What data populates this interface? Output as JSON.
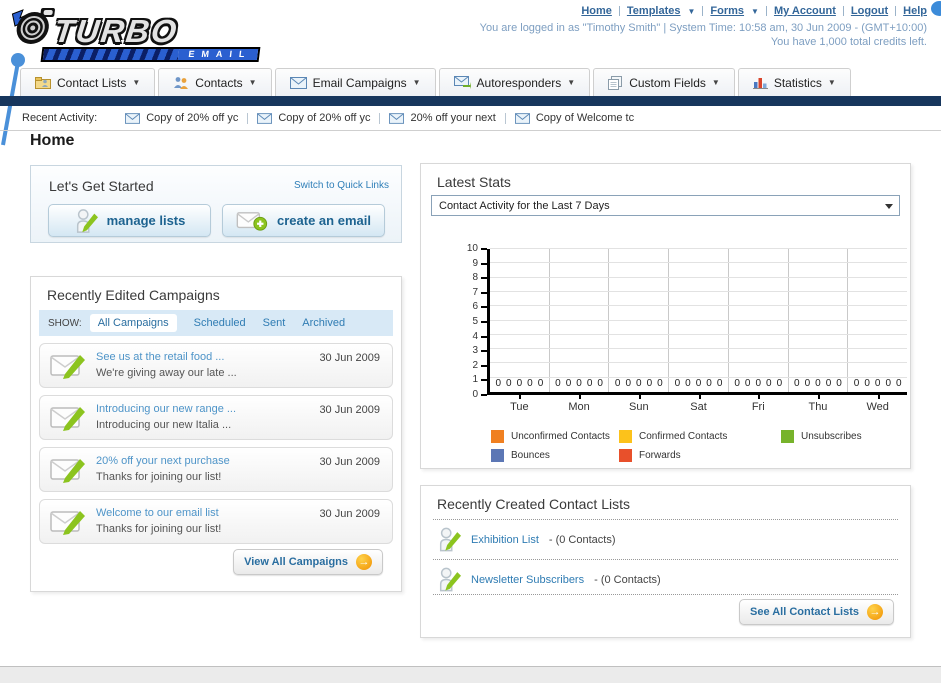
{
  "header": {
    "logo": {
      "title": "TURBO",
      "subtitle": "EMAIL"
    },
    "links": [
      {
        "label": "Home"
      },
      {
        "label": "Templates"
      },
      {
        "label": "Forms"
      },
      {
        "label": "My Account"
      },
      {
        "label": "Logout"
      },
      {
        "label": "Help"
      }
    ],
    "login_info": "You are logged in as \"Timothy Smith\" | System Time: 10:58 am, 30 Jun 2009 - (GMT+10:00)",
    "credits_info": "You have 1,000 total credits left."
  },
  "nav": {
    "tabs": [
      {
        "label": "Contact Lists"
      },
      {
        "label": "Contacts"
      },
      {
        "label": "Email Campaigns"
      },
      {
        "label": "Autoresponders"
      },
      {
        "label": "Custom Fields"
      },
      {
        "label": "Statistics"
      }
    ]
  },
  "recent_activity": {
    "label": "Recent Activity:",
    "items": [
      {
        "label": "Copy of 20% off yc"
      },
      {
        "label": "Copy of 20% off yc"
      },
      {
        "label": "20% off your next"
      },
      {
        "label": "Copy of Welcome tc"
      }
    ]
  },
  "page_title": "Home",
  "get_started": {
    "title": "Let's Get Started",
    "switch_link": "Switch to Quick Links",
    "manage_lists_label": "manage lists",
    "create_email_label": "create an email"
  },
  "campaigns": {
    "title": "Recently Edited Campaigns",
    "show_label": "SHOW:",
    "active_filter": "All Campaigns",
    "filters": [
      {
        "label": "Scheduled"
      },
      {
        "label": "Sent"
      },
      {
        "label": "Archived"
      }
    ],
    "items": [
      {
        "title": "See us at the retail food ...",
        "subtitle": "We're giving away our late ...",
        "date": "30 Jun 2009"
      },
      {
        "title": "Introducing our new range ...",
        "subtitle": "Introducing our new Italia ...",
        "date": "30 Jun 2009"
      },
      {
        "title": "20% off your next purchase",
        "subtitle": "Thanks for joining our list!",
        "date": "30 Jun 2009"
      },
      {
        "title": "Welcome to our email list",
        "subtitle": "Thanks for joining our list!",
        "date": "30 Jun 2009"
      }
    ],
    "view_all_label": "View All Campaigns"
  },
  "stats": {
    "title": "Latest Stats",
    "dropdown_value": "Contact Activity for the Last 7 Days"
  },
  "chart_data": {
    "type": "bar",
    "title": "Contact Activity for the Last 7 Days",
    "categories": [
      "Tue",
      "Mon",
      "Sun",
      "Sat",
      "Fri",
      "Thu",
      "Wed"
    ],
    "series": [
      {
        "name": "Unconfirmed Contacts",
        "color": "#F08021",
        "values": [
          0,
          0,
          0,
          0,
          0,
          0,
          0
        ]
      },
      {
        "name": "Confirmed Contacts",
        "color": "#FCC21B",
        "values": [
          0,
          0,
          0,
          0,
          0,
          0,
          0
        ]
      },
      {
        "name": "Unsubscribes",
        "color": "#77B32B",
        "values": [
          0,
          0,
          0,
          0,
          0,
          0,
          0
        ]
      },
      {
        "name": "Bounces",
        "color": "#5C77B5",
        "values": [
          0,
          0,
          0,
          0,
          0,
          0,
          0
        ]
      },
      {
        "name": "Forwards",
        "color": "#E8502B",
        "values": [
          0,
          0,
          0,
          0,
          0,
          0,
          0
        ]
      }
    ],
    "xlabel": "",
    "ylabel": "",
    "ylim": [
      0,
      10
    ],
    "yticks": [
      0,
      1,
      2,
      3,
      4,
      5,
      6,
      7,
      8,
      9,
      10
    ],
    "grid": true,
    "legend_position": "bottom"
  },
  "contact_lists": {
    "title": "Recently Created Contact Lists",
    "items": [
      {
        "name": "Exhibition List",
        "suffix": "- (0 Contacts)"
      },
      {
        "name": "Newsletter Subscribers",
        "suffix": "- (0 Contacts)"
      }
    ],
    "see_all_label": "See All Contact Lists"
  }
}
